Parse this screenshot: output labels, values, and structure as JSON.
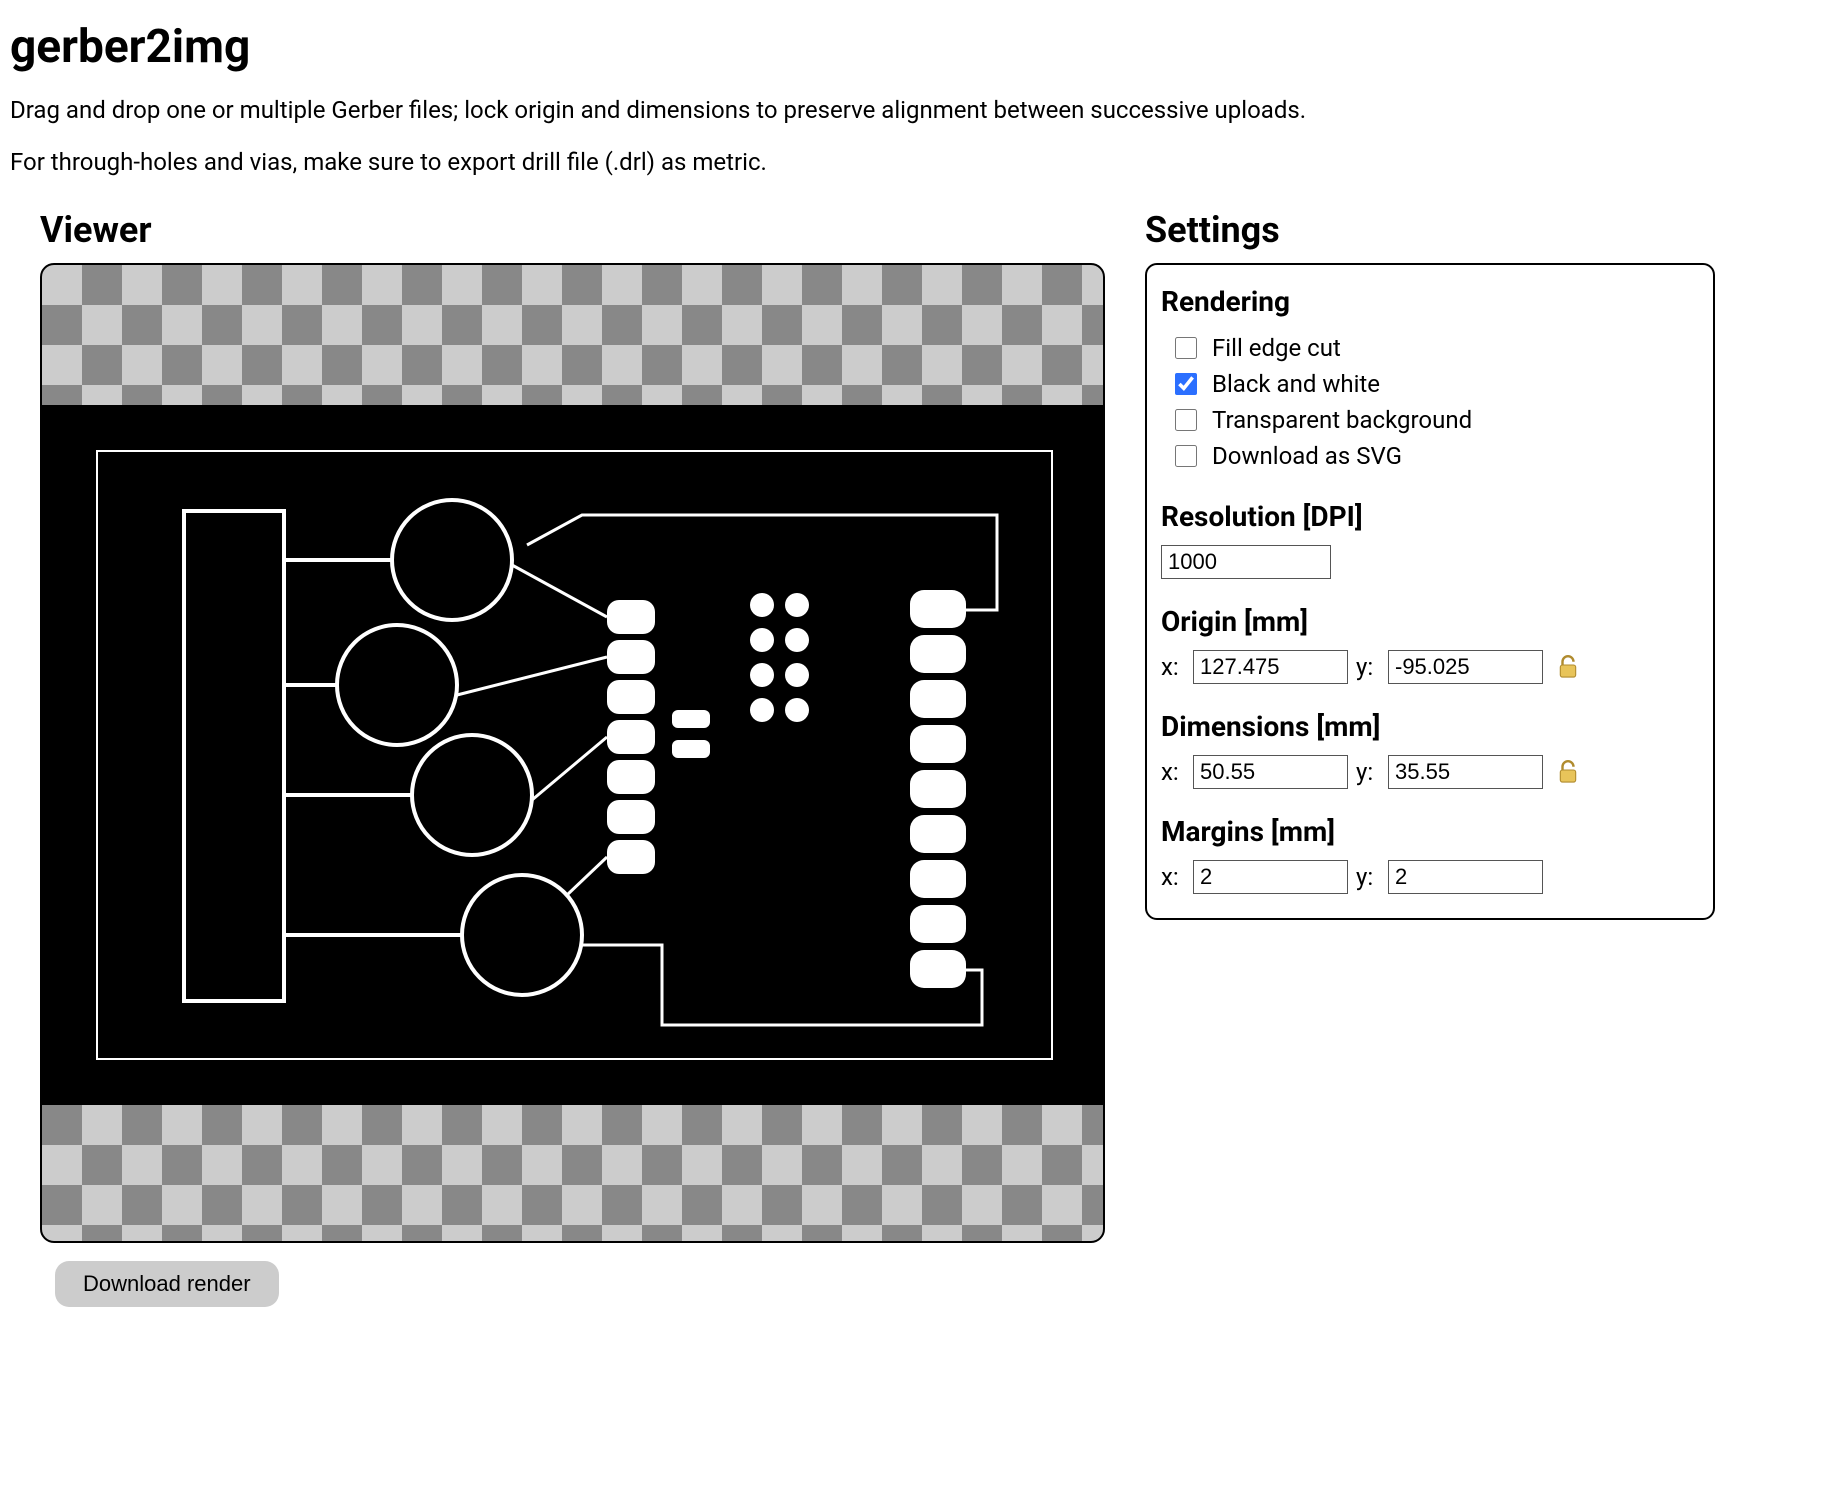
{
  "title": "gerber2img",
  "intro1": "Drag and drop one or multiple Gerber files; lock origin and dimensions to preserve alignment between successive uploads.",
  "intro2": "For through-holes and vias, make sure to export drill file (.drl) as metric.",
  "viewer": {
    "heading": "Viewer"
  },
  "download_btn": "Download render",
  "settings": {
    "heading": "Settings",
    "rendering": {
      "heading": "Rendering",
      "fill_edge": "Fill edge cut",
      "bw": "Black and white",
      "transparent": "Transparent background",
      "svg": "Download as SVG"
    },
    "resolution": {
      "heading": "Resolution [DPI]",
      "value": "1000"
    },
    "origin": {
      "heading": "Origin [mm]",
      "x_label": "x:",
      "x": "127.475",
      "y_label": "y:",
      "y": "-95.025"
    },
    "dimensions": {
      "heading": "Dimensions [mm]",
      "x_label": "x:",
      "x": "50.55",
      "y_label": "y:",
      "y": "35.55"
    },
    "margins": {
      "heading": "Margins [mm]",
      "x_label": "x:",
      "x": "2",
      "y_label": "y:",
      "y": "2"
    }
  }
}
